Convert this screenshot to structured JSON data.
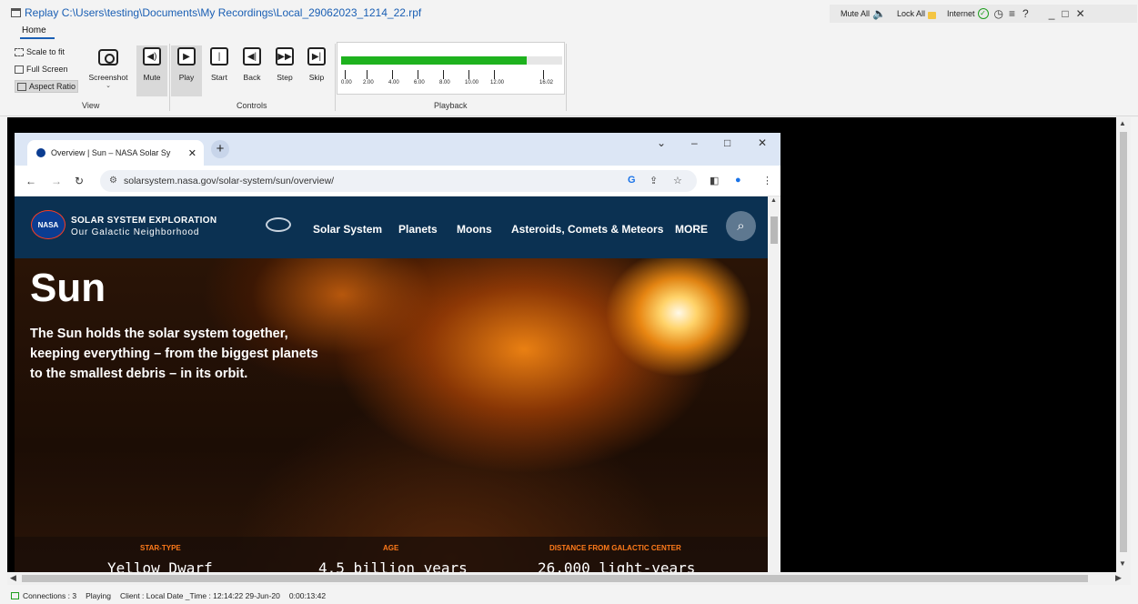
{
  "window": {
    "title": "Replay C:\\Users\\testing\\Documents\\My Recordings\\Local_29062023_1214_22.rpf",
    "tab_home": "Home"
  },
  "top_right": {
    "mute_all": "Mute All",
    "lock_all": "Lock All",
    "internet": "Internet",
    "help": "?",
    "minimize": "_",
    "maximize": "□",
    "close": "✕"
  },
  "ribbon": {
    "scale_to_fit": "Scale to fit",
    "full_screen": "Full Screen",
    "aspect_ratio": "Aspect Ratio",
    "screenshot": "Screenshot",
    "mute": "Mute",
    "play": "Play",
    "start": "Start",
    "back": "Back",
    "step": "Step",
    "skip": "Skip",
    "group_view": "View",
    "group_controls": "Controls",
    "group_playback": "Playback"
  },
  "playback": {
    "progress_fraction": 0.84,
    "ticks": [
      "0.00",
      "2.00",
      "4.00",
      "6.00",
      "8.00",
      "10.00",
      "12.00",
      "16.02"
    ]
  },
  "browser": {
    "tab_title": "Overview | Sun – NASA Solar Sy",
    "url": "solarsystem.nasa.gov/solar-system/sun/overview/",
    "new_tab": "+",
    "minimize": "⌄",
    "restore": "–",
    "maximize": "□",
    "close": "✕"
  },
  "site": {
    "logo_text": "NASA",
    "name_line1": "SOLAR SYSTEM EXPLORATION",
    "name_line2": "Our Galactic Neighborhood",
    "nav": [
      "Solar System",
      "Planets",
      "Moons",
      "Asteroids, Comets & Meteors",
      "MORE"
    ],
    "hero_title": "Sun",
    "hero_desc": "The Sun holds the solar system together, keeping everything – from the biggest planets to the smallest debris – in its orbit.",
    "stats": [
      {
        "label": "STAR-TYPE",
        "value": "Yellow Dwarf"
      },
      {
        "label": "AGE",
        "value": "4.5 billion years"
      },
      {
        "label": "DISTANCE FROM GALACTIC CENTER",
        "value": "26,000 light-years"
      }
    ]
  },
  "status": {
    "connections": "Connections : 3",
    "state": "Playing",
    "client": "Client : Local Date _Time : 12:14:22  29-Jun-20",
    "elapsed": "0:00:13:42"
  }
}
